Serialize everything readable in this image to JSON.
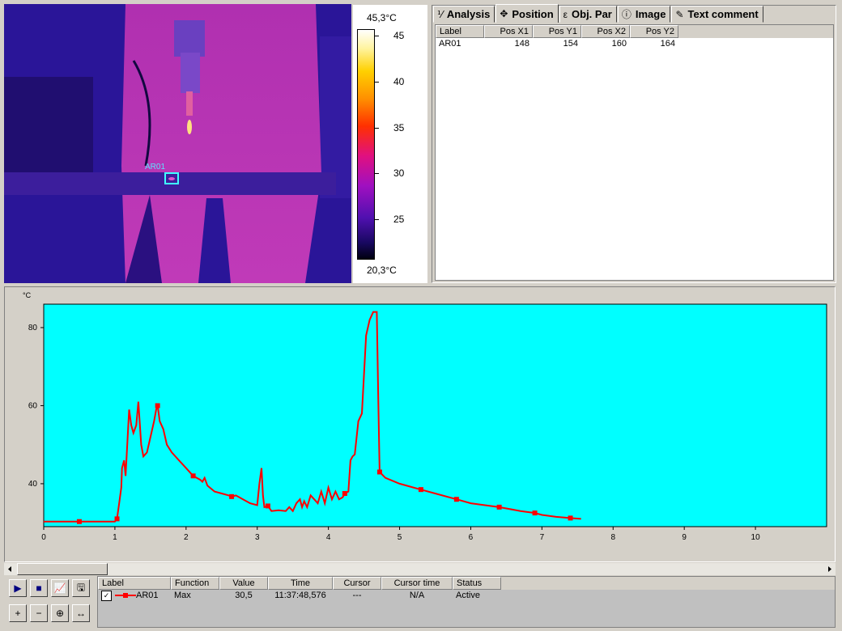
{
  "thermal_image": {
    "roi_label": "AR01",
    "scale_max": "45,3°C",
    "scale_min": "20,3°C",
    "scale_ticks": [
      "45",
      "40",
      "35",
      "30",
      "25"
    ]
  },
  "tabs": [
    {
      "label": "Analysis",
      "icon": "analysis-icon",
      "active": false
    },
    {
      "label": "Position",
      "icon": "position-icon",
      "active": true
    },
    {
      "label": "Obj. Par",
      "icon": "object-parameters-icon",
      "active": false
    },
    {
      "label": "Image",
      "icon": "info-icon",
      "active": false
    },
    {
      "label": "Text comment",
      "icon": "text-comment-icon",
      "active": false
    }
  ],
  "position_table": {
    "columns": [
      "Label",
      "Pos X1",
      "Pos Y1",
      "Pos X2",
      "Pos Y2"
    ],
    "rows": [
      [
        "AR01",
        "148",
        "154",
        "160",
        "164"
      ]
    ]
  },
  "chart_data": {
    "type": "line",
    "ylabel": "°C",
    "xlim": [
      0,
      11
    ],
    "ylim": [
      29,
      86
    ],
    "x_ticks": [
      0,
      1,
      2,
      3,
      4,
      5,
      6,
      7,
      8,
      9,
      10
    ],
    "y_ticks": [
      40,
      60,
      80
    ],
    "background": "#00ffff",
    "series": [
      {
        "color": "#ff0000",
        "points": [
          [
            0,
            30.3
          ],
          [
            0.5,
            30.3
          ],
          [
            1,
            30.3
          ],
          [
            1.03,
            31
          ],
          [
            1.06,
            35
          ],
          [
            1.09,
            39
          ],
          [
            1.1,
            44
          ],
          [
            1.13,
            46
          ],
          [
            1.15,
            42
          ],
          [
            1.18,
            52
          ],
          [
            1.2,
            59
          ],
          [
            1.23,
            55
          ],
          [
            1.26,
            53
          ],
          [
            1.3,
            55
          ],
          [
            1.33,
            61
          ],
          [
            1.37,
            50
          ],
          [
            1.4,
            47
          ],
          [
            1.45,
            48
          ],
          [
            1.5,
            52
          ],
          [
            1.55,
            56
          ],
          [
            1.58,
            59
          ],
          [
            1.6,
            60
          ],
          [
            1.63,
            56
          ],
          [
            1.68,
            54
          ],
          [
            1.73,
            50
          ],
          [
            1.8,
            48
          ],
          [
            1.9,
            46
          ],
          [
            2,
            44
          ],
          [
            2.1,
            42
          ],
          [
            2.2,
            41
          ],
          [
            2.23,
            40.5
          ],
          [
            2.26,
            41.5
          ],
          [
            2.3,
            39.5
          ],
          [
            2.4,
            38
          ],
          [
            2.5,
            37.5
          ],
          [
            2.6,
            37
          ],
          [
            2.64,
            36.7
          ],
          [
            2.7,
            37
          ],
          [
            2.8,
            36
          ],
          [
            2.9,
            35
          ],
          [
            3,
            34.5
          ],
          [
            3.03,
            40
          ],
          [
            3.06,
            44
          ],
          [
            3.08,
            37
          ],
          [
            3.1,
            34
          ],
          [
            3.15,
            34.3
          ],
          [
            3.2,
            33
          ],
          [
            3.3,
            33.2
          ],
          [
            3.4,
            33
          ],
          [
            3.45,
            34
          ],
          [
            3.5,
            33
          ],
          [
            3.55,
            35
          ],
          [
            3.6,
            36
          ],
          [
            3.63,
            34
          ],
          [
            3.66,
            35.5
          ],
          [
            3.7,
            34
          ],
          [
            3.75,
            37
          ],
          [
            3.8,
            36
          ],
          [
            3.85,
            35
          ],
          [
            3.9,
            38
          ],
          [
            3.95,
            35
          ],
          [
            4,
            39
          ],
          [
            4.05,
            36
          ],
          [
            4.1,
            38
          ],
          [
            4.15,
            36
          ],
          [
            4.2,
            36.5
          ],
          [
            4.23,
            37.5
          ],
          [
            4.28,
            38
          ],
          [
            4.31,
            46
          ],
          [
            4.34,
            47
          ],
          [
            4.37,
            47.5
          ],
          [
            4.42,
            56
          ],
          [
            4.47,
            58
          ],
          [
            4.53,
            78
          ],
          [
            4.58,
            82
          ],
          [
            4.63,
            84
          ],
          [
            4.68,
            84
          ],
          [
            4.7,
            62
          ],
          [
            4.72,
            43
          ],
          [
            4.8,
            41.5
          ],
          [
            5,
            40
          ],
          [
            5.3,
            38.5
          ],
          [
            5.5,
            37.5
          ],
          [
            5.8,
            36
          ],
          [
            6,
            35
          ],
          [
            6.2,
            34.5
          ],
          [
            6.4,
            34
          ],
          [
            6.7,
            33
          ],
          [
            6.9,
            32.5
          ],
          [
            7,
            32
          ],
          [
            7.2,
            31.5
          ],
          [
            7.4,
            31.2
          ],
          [
            7.55,
            31
          ]
        ],
        "markers": [
          [
            0.5,
            30.3
          ],
          [
            1.03,
            31
          ],
          [
            1.6,
            60
          ],
          [
            2.1,
            42
          ],
          [
            2.64,
            36.7
          ],
          [
            3.15,
            34.3
          ],
          [
            4.23,
            37.5
          ],
          [
            4.72,
            43
          ],
          [
            5.3,
            38.5
          ],
          [
            5.8,
            36
          ],
          [
            6.4,
            34
          ],
          [
            6.9,
            32.5
          ],
          [
            7.4,
            31.2
          ]
        ]
      }
    ]
  },
  "toolbar": {
    "buttons": [
      {
        "name": "play-button",
        "icon": "▶"
      },
      {
        "name": "stop-button",
        "icon": "■"
      },
      {
        "name": "chart-settings-button",
        "icon": "📈"
      },
      {
        "name": "export-button",
        "icon": "🖫"
      },
      {
        "name": "zoom-in-button",
        "icon": "+"
      },
      {
        "name": "zoom-out-button",
        "icon": "−"
      },
      {
        "name": "zoom-fit-button",
        "icon": "⊕"
      },
      {
        "name": "pan-button",
        "icon": "↔"
      }
    ]
  },
  "measure_table": {
    "columns": [
      "Label",
      "Function",
      "Value",
      "Time",
      "Cursor",
      "Cursor time",
      "Status"
    ],
    "rows": [
      {
        "checked": true,
        "label": "AR01",
        "function": "Max",
        "value": "30,5",
        "time": "11:37:48,576",
        "cursor": "---",
        "cursor_time": "N/A",
        "status": "Active"
      }
    ]
  }
}
